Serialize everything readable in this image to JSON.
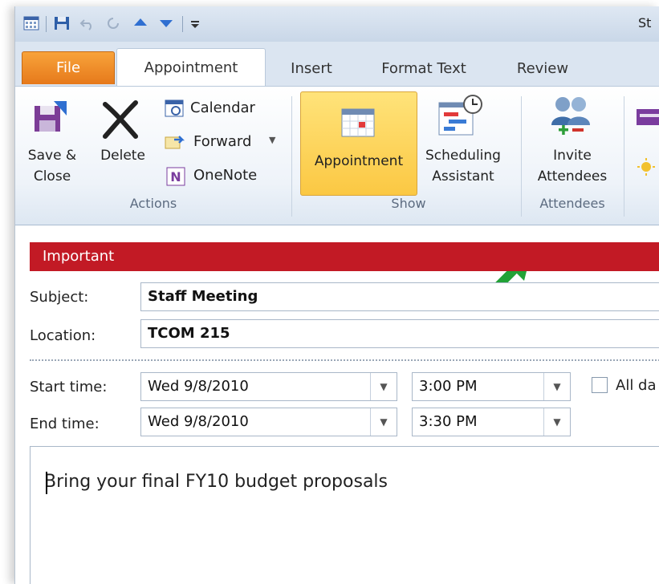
{
  "window": {
    "title_fragment": "St"
  },
  "tabs": [
    {
      "label": "File"
    },
    {
      "label": "Appointment"
    },
    {
      "label": "Insert"
    },
    {
      "label": "Format Text"
    },
    {
      "label": "Review"
    }
  ],
  "ribbon": {
    "actions": {
      "group_label": "Actions",
      "save_close_line1": "Save &",
      "save_close_line2": "Close",
      "delete": "Delete",
      "calendar": "Calendar",
      "forward": "Forward",
      "onenote": "OneNote"
    },
    "show": {
      "group_label": "Show",
      "appointment": "Appointment",
      "scheduling_line1": "Scheduling",
      "scheduling_line2": "Assistant"
    },
    "attendees": {
      "group_label": "Attendees",
      "invite_line1": "Invite",
      "invite_line2": "Attendees"
    }
  },
  "form": {
    "info_bar": "Important",
    "subject_label": "Subject:",
    "subject_value": "Staff Meeting",
    "location_label": "Location:",
    "location_value": "TCOM 215",
    "start_label": "Start time:",
    "start_date": "Wed 9/8/2010",
    "start_time": "3:00 PM",
    "all_day_label": "All da",
    "end_label": "End time:",
    "end_date": "Wed 9/8/2010",
    "end_time": "3:30 PM",
    "body_text": "Bring your final FY10 budget proposals"
  },
  "colors": {
    "file_tab": "#e6791b",
    "info_bar": "#c21a25",
    "highlight": "#fbc843",
    "arrow": "#22a236"
  }
}
